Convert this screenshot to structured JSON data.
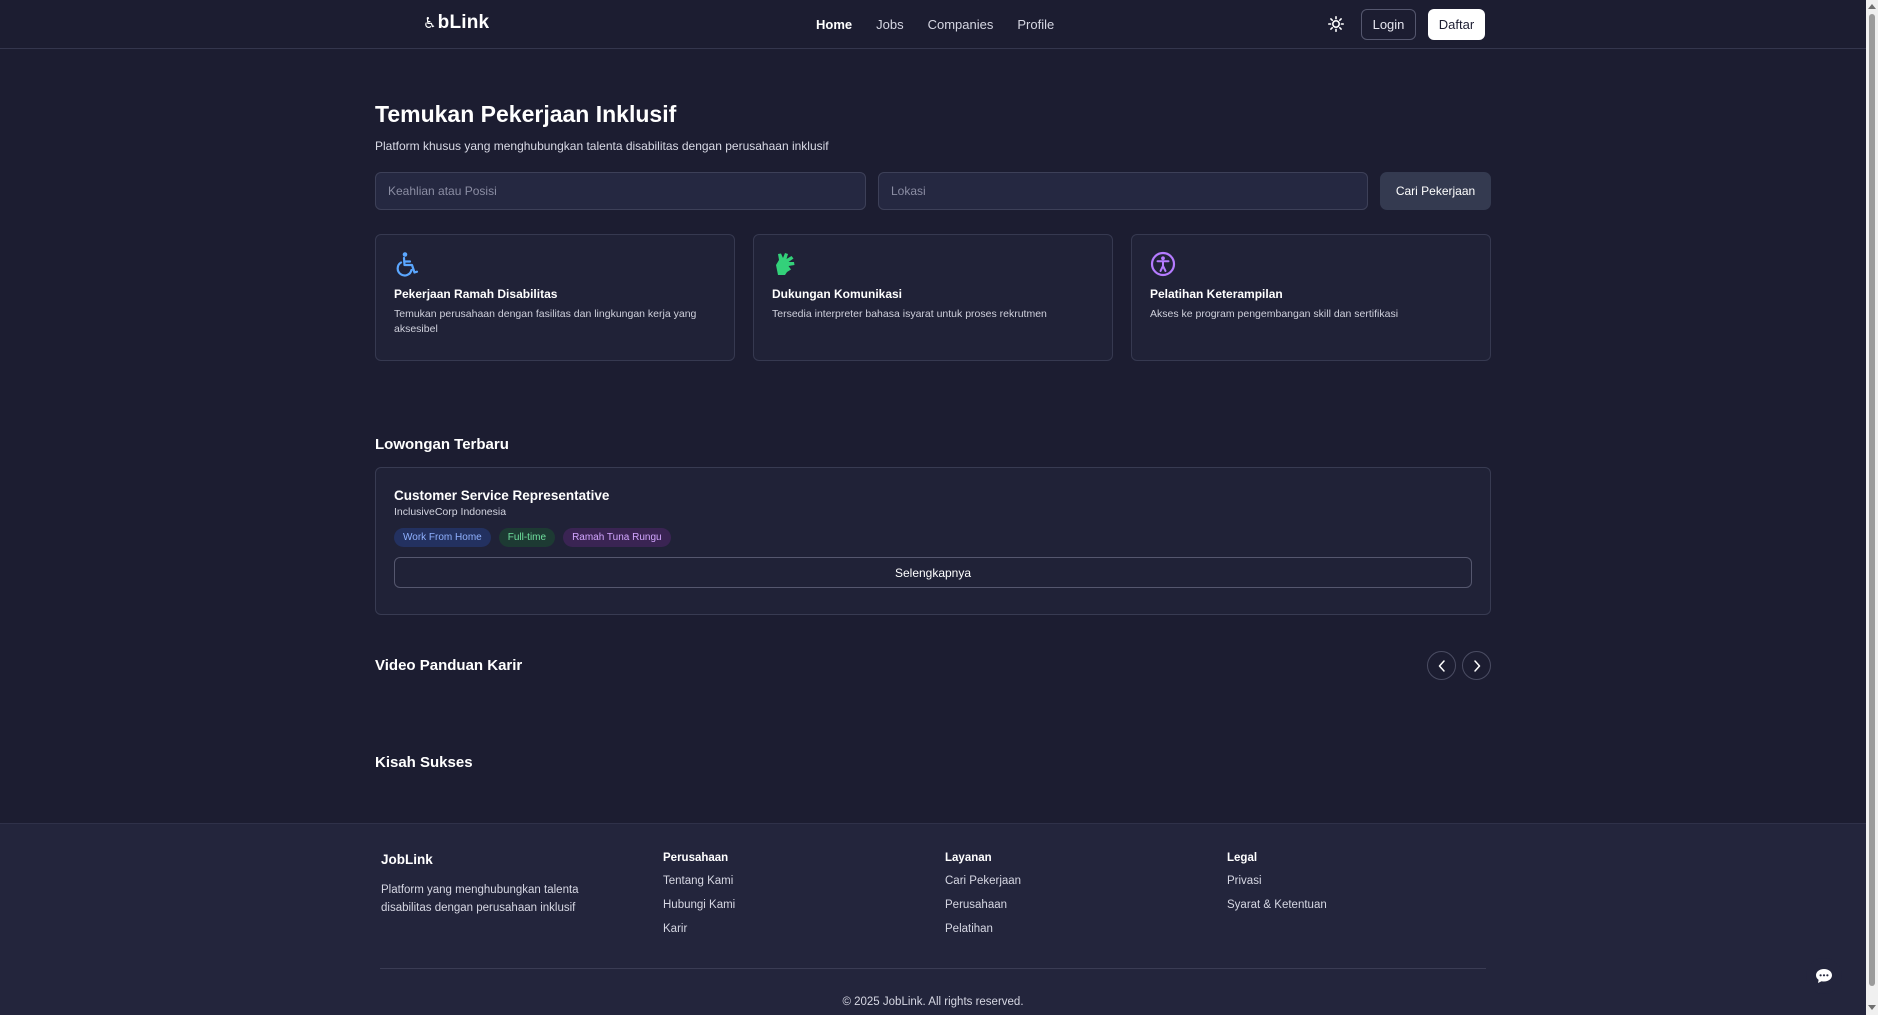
{
  "nav": {
    "logo": "bLink",
    "links": [
      "Home",
      "Jobs",
      "Companies",
      "Profile"
    ],
    "login": "Login",
    "daftar": "Daftar"
  },
  "hero": {
    "title": "Temukan Pekerjaan Inklusif",
    "subtitle": "Platform khusus yang menghubungkan talenta disabilitas dengan perusahaan inklusif",
    "skill_placeholder": "Keahlian atau Posisi",
    "location_placeholder": "Lokasi",
    "search_button": "Cari Pekerjaan"
  },
  "features": [
    {
      "icon": "wheelchair-icon",
      "color": "#5ba7ff",
      "title": "Pekerjaan Ramah Disabilitas",
      "desc": "Temukan perusahaan dengan fasilitas dan lingkungan kerja yang aksesibel"
    },
    {
      "icon": "sign-language-hand-icon",
      "color": "#33d17a",
      "title": "Dukungan Komunikasi",
      "desc": "Tersedia interpreter bahasa isyarat untuk proses rekrutmen"
    },
    {
      "icon": "accessibility-icon",
      "color": "#b57bff",
      "title": "Pelatihan Keterampilan",
      "desc": "Akses ke program pengembangan skill dan sertifikasi"
    }
  ],
  "jobs_section": {
    "title": "Lowongan Terbaru",
    "job": {
      "title": "Customer Service Representative",
      "company": "InclusiveCorp Indonesia",
      "tags": [
        "Work From Home",
        "Full-time",
        "Ramah Tuna Rungu"
      ],
      "more_button": "Selengkapnya"
    }
  },
  "video_section": {
    "title": "Video Panduan Karir"
  },
  "success_section": {
    "title": "Kisah Sukses"
  },
  "footer": {
    "brand": "JobLink",
    "desc": "Platform yang menghubungkan talenta disabilitas dengan perusahaan inklusif",
    "columns": [
      {
        "heading": "Perusahaan",
        "links": [
          "Tentang Kami",
          "Hubungi Kami",
          "Karir"
        ]
      },
      {
        "heading": "Layanan",
        "links": [
          "Cari Pekerjaan",
          "Perusahaan",
          "Pelatihan"
        ]
      },
      {
        "heading": "Legal",
        "links": [
          "Privasi",
          "Syarat & Ketentuan"
        ]
      }
    ],
    "copyright": "© 2025 JobLink. All rights reserved."
  }
}
